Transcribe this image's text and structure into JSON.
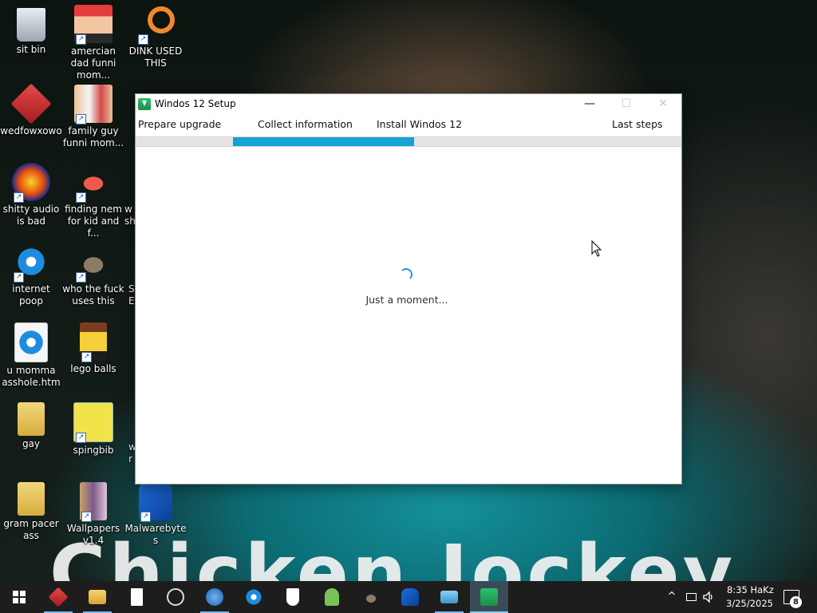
{
  "desktop": {
    "wallpaper_caption": "Chicken Jockey",
    "icons": [
      {
        "label": "sit bin",
        "icon": "recycle-bin-icon"
      },
      {
        "label": "amercian dad funni mom...",
        "icon": "cartoon-face-icon"
      },
      {
        "label": "DINK USED THIS",
        "icon": "search-app-icon"
      },
      {
        "label": "wedfowxowo",
        "icon": "red-cube-icon"
      },
      {
        "label": "family guy funni mom...",
        "icon": "cartoon-group-icon"
      },
      {
        "label": "shitty audio is bad",
        "icon": "audio-app-icon"
      },
      {
        "label": "finding nem for kid and f...",
        "icon": "fish-icon"
      },
      {
        "label": "internet poop",
        "icon": "internet-explorer-icon"
      },
      {
        "label": "who the fuck uses this",
        "icon": "gimp-icon"
      },
      {
        "label": "u momma asshole.htm",
        "icon": "ie-html-file-icon"
      },
      {
        "label": "lego balls",
        "icon": "lego-figure-icon"
      },
      {
        "label": "gay",
        "icon": "folder-icon"
      },
      {
        "label": "spingbib",
        "icon": "sponge-icon"
      },
      {
        "label": "gram pacer ass",
        "icon": "folder-icon"
      },
      {
        "label": "Wallpapers v1.4",
        "icon": "wallpaper-app-icon"
      },
      {
        "label": "Malwarebytes",
        "icon": "malwarebytes-icon"
      }
    ],
    "partial_labels": {
      "row3": "w",
      "row3b": "sh",
      "row4": "S",
      "row4b": "EV",
      "row6": "w",
      "row6b": "r"
    }
  },
  "window": {
    "title": "Windos 12 Setup",
    "minimize": "—",
    "maximize": "☐",
    "close": "✕",
    "steps": [
      "Prepare upgrade",
      "Collect information",
      "Install Windos 12",
      "Last steps"
    ],
    "status": "Just a moment...",
    "accent_color": "#14a3d6"
  },
  "taskbar": {
    "apps": [
      "start-icon",
      "red-cube-icon",
      "file-explorer-icon",
      "notepad-icon",
      "obs-icon",
      "browser-globe-icon",
      "internet-explorer-icon",
      "shield-icon",
      "android-icon",
      "gimp-icon",
      "malwarebytes-icon",
      "remote-desktop-icon",
      "setup-icon"
    ],
    "clock_time": "8:35 HaKz",
    "clock_date": "3/25/2025",
    "notification_count": "8"
  }
}
